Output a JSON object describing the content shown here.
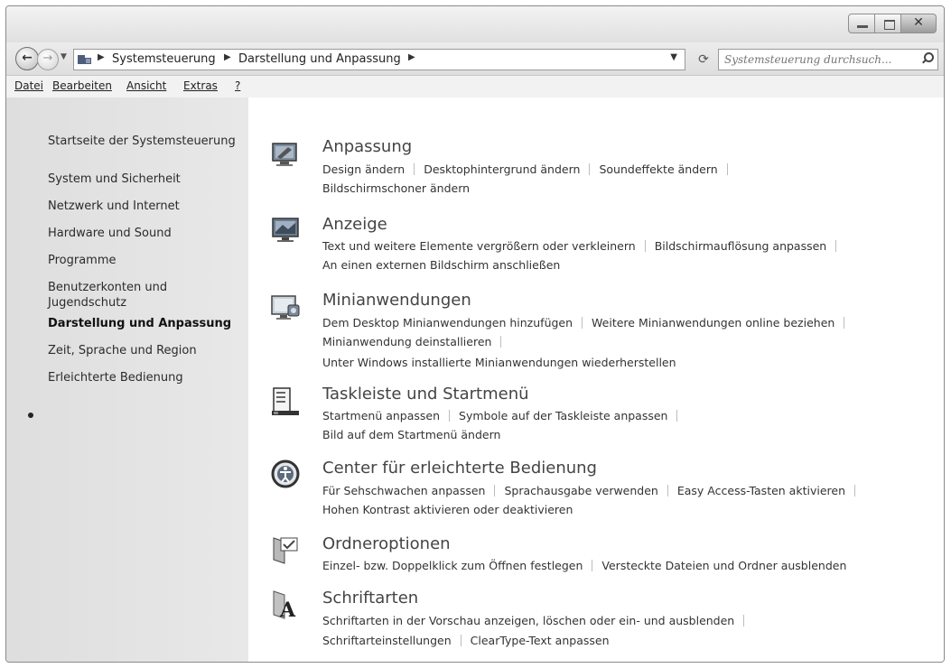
{
  "address": {
    "crumbs": [
      "Systemsteuerung",
      "Darstellung und Anpassung"
    ],
    "search_placeholder": "Systemsteuerung durchsuch..."
  },
  "menu": [
    "Datei",
    "Bearbeiten",
    "Ansicht",
    "Extras",
    "?"
  ],
  "sidebar": {
    "home": "Startseite der Systemsteuerung",
    "items": [
      "System und Sicherheit",
      "Netzwerk und Internet",
      "Hardware und Sound",
      "Programme",
      "Benutzerkonten und",
      "Jugendschutz",
      "Darstellung und Anpassung",
      "Zeit, Sprache und Region",
      "Erleichterte Bedienung"
    ]
  },
  "categories": [
    {
      "title": "Anpassung",
      "icon": "personalization-icon",
      "links": [
        "Design ändern",
        "Desktophintergrund ändern",
        "Soundeffekte ändern",
        "Bildschirmschoner ändern"
      ]
    },
    {
      "title": "Anzeige",
      "icon": "display-icon",
      "links": [
        "Text und weitere Elemente vergrößern oder verkleinern",
        "Bildschirmauflösung anpassen",
        "An einen externen Bildschirm anschließen"
      ]
    },
    {
      "title": "Minianwendungen",
      "icon": "gadgets-icon",
      "links": [
        "Dem Desktop Minianwendungen hinzufügen",
        "Weitere Minianwendungen online beziehen",
        "Minianwendung deinstallieren",
        "Unter Windows installierte Minianwendungen wiederherstellen"
      ]
    },
    {
      "title": "Taskleiste und Startmenü",
      "icon": "taskbar-icon",
      "links": [
        "Startmenü anpassen",
        "Symbole auf der Taskleiste anpassen",
        "Bild auf dem Startmenü ändern"
      ]
    },
    {
      "title": "Center für erleichterte Bedienung",
      "icon": "ease-of-access-icon",
      "links": [
        "Für Sehschwachen anpassen",
        "Sprachausgabe verwenden",
        "Easy Access-Tasten aktivieren",
        "Hohen Kontrast aktivieren oder deaktivieren"
      ]
    },
    {
      "title": "Ordneroptionen",
      "icon": "folder-options-icon",
      "links": [
        "Einzel- bzw. Doppelklick zum Öffnen festlegen",
        "Versteckte Dateien und Ordner ausblenden"
      ]
    },
    {
      "title": "Schriftarten",
      "icon": "fonts-icon",
      "links": [
        "Schriftarten in der Vorschau anzeigen, löschen oder ein- und ausblenden",
        "Schriftarteinstellungen",
        "ClearType-Text anpassen"
      ]
    }
  ]
}
